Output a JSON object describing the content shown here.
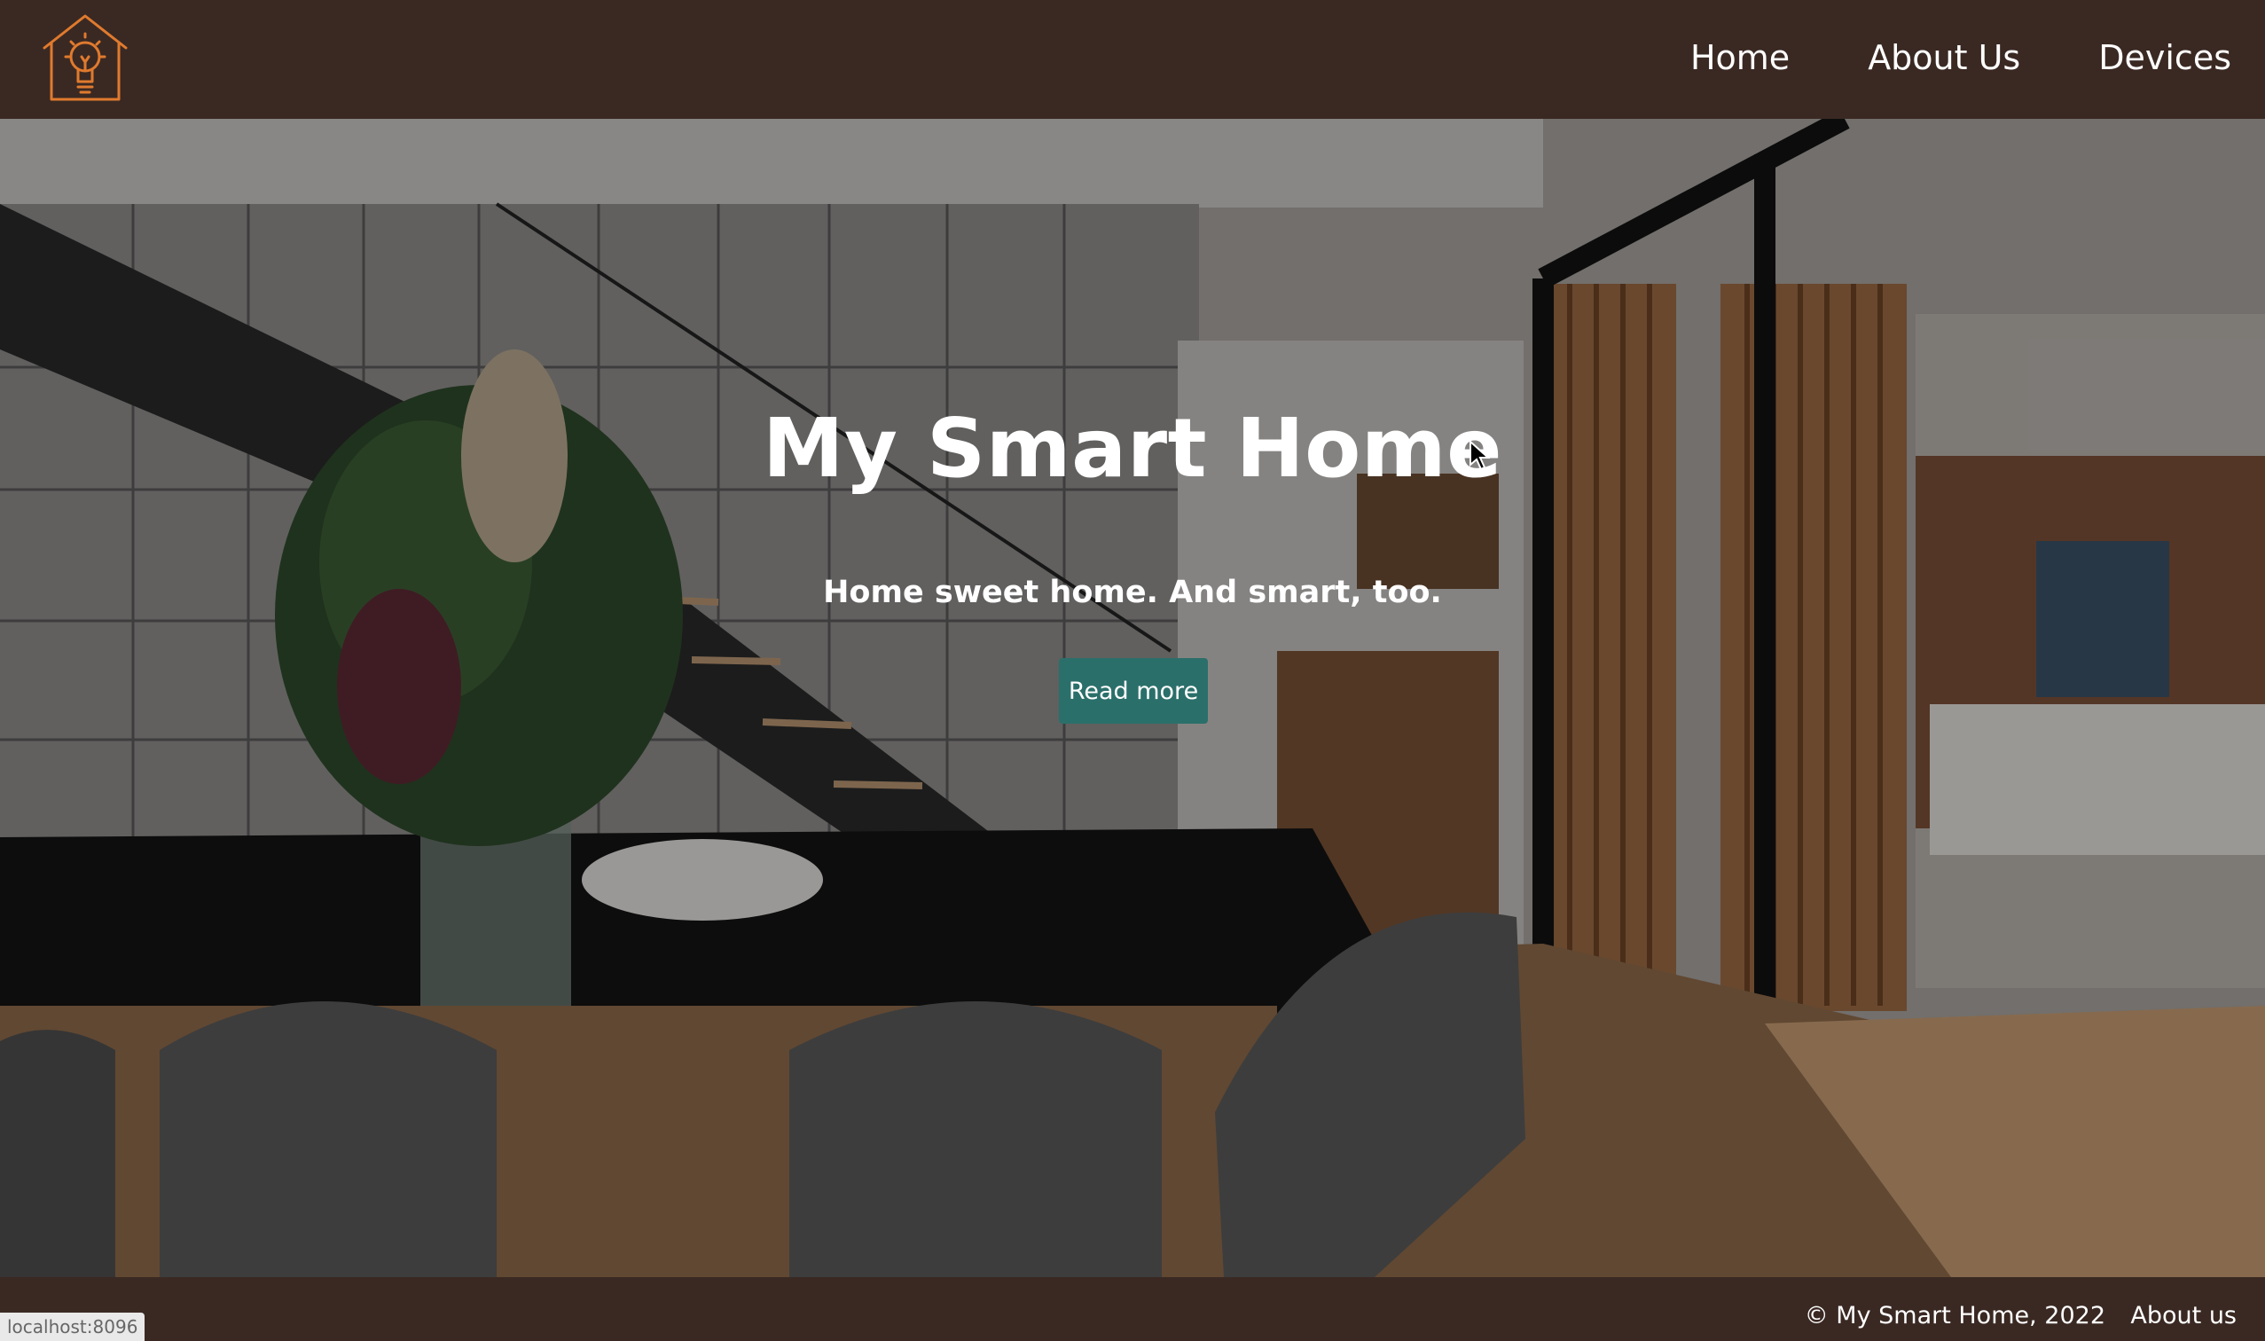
{
  "header": {
    "logo_icon": "smart-home-lightbulb-icon",
    "nav": [
      {
        "label": "Home"
      },
      {
        "label": "About Us"
      },
      {
        "label": "Devices"
      }
    ]
  },
  "hero": {
    "title": "My Smart Home",
    "subtitle": "Home sweet home. And smart, too.",
    "button_label": "Read more"
  },
  "footer": {
    "copyright": "© My Smart Home, 2022",
    "link": "About us"
  },
  "status_bar": {
    "url": "localhost:8096"
  },
  "colors": {
    "header_bg": "#3a2923",
    "accent": "#e07a2e",
    "button_bg": "#2b6f6a"
  }
}
